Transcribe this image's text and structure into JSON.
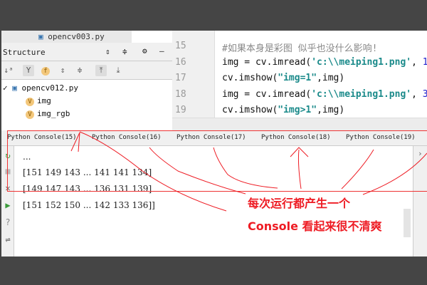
{
  "left_panel": {
    "file_tab": "opencv003.py",
    "structure_title": "Structure",
    "tree": {
      "file": "opencv012.py",
      "items": [
        {
          "badge": "V",
          "label": "img"
        },
        {
          "badge": "V",
          "label": "img_rgb"
        }
      ]
    }
  },
  "editor": {
    "lines": [
      {
        "n": "15",
        "parts": [
          [
            "cmt",
            "#如果本身是彩图 似乎也没什么影响!"
          ]
        ]
      },
      {
        "n": "16",
        "parts": [
          [
            "",
            "img = cv.imread("
          ],
          [
            "str",
            "'c:\\\\meiping1.png'"
          ],
          [
            "",
            ", "
          ],
          [
            "num",
            "1"
          ],
          [
            "",
            ")"
          ]
        ]
      },
      {
        "n": "17",
        "parts": [
          [
            "",
            "cv.imshow("
          ],
          [
            "str",
            "\"img=1\""
          ],
          [
            "",
            ",img)"
          ]
        ]
      },
      {
        "n": "18",
        "parts": [
          [
            "",
            "img = cv.imread("
          ],
          [
            "str",
            "'c:\\\\meiping1.png'"
          ],
          [
            "",
            ", "
          ],
          [
            "num",
            "3"
          ],
          [
            "",
            ")"
          ]
        ]
      },
      {
        "n": "19",
        "parts": [
          [
            "",
            "cv.imshow("
          ],
          [
            "str",
            "\"img>1\""
          ],
          [
            "",
            ",img)"
          ]
        ]
      }
    ]
  },
  "console": {
    "tabs": [
      "Python Console(15)",
      "Python Console(16)",
      "Python Console(17)",
      "Python Console(18)",
      "Python Console(19)"
    ],
    "output": [
      "...",
      "[151 149 143 ... 141 141 134]",
      "[149 147 143 ... 136 131 139]",
      "[151 152 150 ... 142 133 136]]"
    ]
  },
  "annotation": {
    "line1": "每次运行都产生一个",
    "line2": "Console 看起来很不清爽",
    "color": "#ee1c24"
  }
}
